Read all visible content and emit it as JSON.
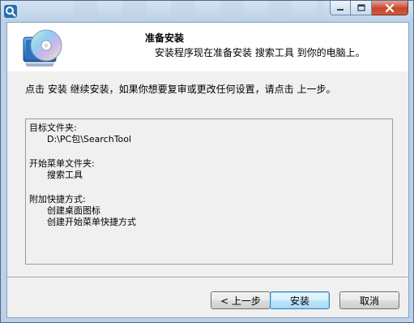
{
  "window": {
    "title": "",
    "icon": "app-magnifier-icon",
    "buttons": [
      "minimize-icon",
      "maximize-icon",
      "close-icon"
    ]
  },
  "header": {
    "title": "准备安装",
    "subtitle": "安装程序现在准备安装 搜索工具 到你的电脑上。",
    "icon": "install-cd-icon"
  },
  "instruction": "点击 安装 继续安装，如果你想要复审或更改任何设置，请点击 上一步。",
  "memo": {
    "dest_label": "目标文件夹:",
    "dest_value": "D:\\PC包\\SearchTool",
    "start_menu_label": "开始菜单文件夹:",
    "start_menu_value": "搜索工具",
    "tasks_label": "附加快捷方式:",
    "tasks": [
      "创建桌面图标",
      "创建开始菜单快捷方式"
    ]
  },
  "buttons": {
    "back": "< 上一步",
    "install": "安装",
    "cancel": "取消"
  },
  "colors": {
    "titlebar": "#bcd0e6",
    "client_bg": "#f0f0f0",
    "close_button": "#c8452c",
    "default_button_border": "#3c7fb1"
  }
}
